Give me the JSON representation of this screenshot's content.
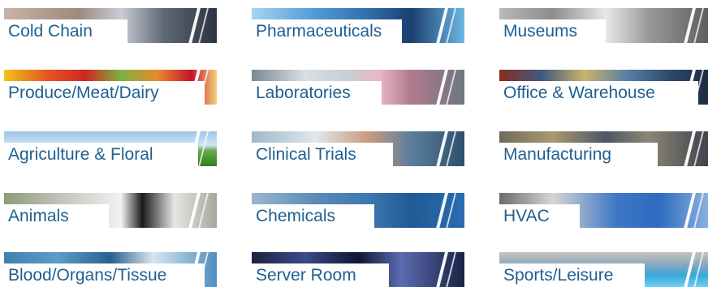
{
  "tiles": [
    {
      "label": "Cold Chain",
      "bg": "linear-gradient(90deg,#c8b4a6 0%,#9e8a7d 35%,#c9ccd4 55%,#5f6877 75%,#2c3342 100%)"
    },
    {
      "label": "Pharmaceuticals",
      "bg": "linear-gradient(90deg,#a8d4f0 0%,#4f9ad4 30%,#2f6fa8 55%,#1a3f6f 75%,#6db6e6 100%)"
    },
    {
      "label": "Museums",
      "bg": "linear-gradient(90deg,#b9b9b9 0%,#8c8c8c 25%,#e8e8e8 50%,#9a9a9a 70%,#5b5b5b 100%)"
    },
    {
      "label": "Produce/Meat/Dairy",
      "bg": "linear-gradient(90deg,#f0c419 0%,#e6561f 20%,#d0261f 38%,#7cb342 55%,#e88a2c 72%,#c4152b 88%,#f5d27a 100%)"
    },
    {
      "label": "Laboratories",
      "bg": "linear-gradient(90deg,#7a8a93 0%,#d9dfe3 25%,#c7cfd4 45%,#e7b7c4 60%,#b07a8e 75%,#6b7780 100%)"
    },
    {
      "label": "Office & Warehouse",
      "bg": "linear-gradient(90deg,#8a2c1e 0%,#3d5a80 20%,#c9b46b 40%,#5a7ea3 60%,#2d4a6b 80%,#1d2a3a 100%)"
    },
    {
      "label": "Agriculture & Floral",
      "bg": "linear-gradient(180deg,#9fc3e8 0%,#cfe4f5 40%,#6aa84f 55%,#2f7d1f 100%)"
    },
    {
      "label": "Clinical Trials",
      "bg": "linear-gradient(90deg,#9fb8c9 0%,#dfe7ec 30%,#c79a7f 55%,#5b7e9c 75%,#2f4f6f 100%)"
    },
    {
      "label": "Manufacturing",
      "bg": "linear-gradient(90deg,#6f6a5a 0%,#a89a6f 25%,#4f5566 50%,#8c8676 70%,#3a3f4a 100%)"
    },
    {
      "label": "Animals",
      "bg": "linear-gradient(90deg,#8f9a7a 0%,#c7c9c1 30%,#f2f2f2 55%,#1b1b1b 65%,#e6e6e6 80%,#a4a89a 100%)"
    },
    {
      "label": "Chemicals",
      "bg": "linear-gradient(90deg,#9bb6cf 0%,#5a8bb8 30%,#3d78b0 55%,#1f5a95 75%,#2a6cb0 100%)"
    },
    {
      "label": "HVAC",
      "bg": "linear-gradient(90deg,#6b6b6b 0%,#d6d6d6 25%,#3e78c4 55%,#2e6bbf 75%,#8fb6e0 100%)"
    },
    {
      "label": "Blood/Organs/Tissue",
      "bg": "linear-gradient(90deg,#3f7fb0 0%,#5c9dc7 25%,#2a5f8f 50%,#d7e6ef 70%,#4d8fbf 100%)"
    },
    {
      "label": "Server Room",
      "bg": "linear-gradient(90deg,#1b2340 0%,#3a4a88 25%,#0f1630 50%,#5b6bb0 70%,#1a2245 100%)"
    },
    {
      "label": "Sports/Leisure",
      "bg": "linear-gradient(180deg,#c9c3b5 0%,#7fa6c2 40%,#39a7d8 65%,#6fd0f0 100%)"
    }
  ]
}
